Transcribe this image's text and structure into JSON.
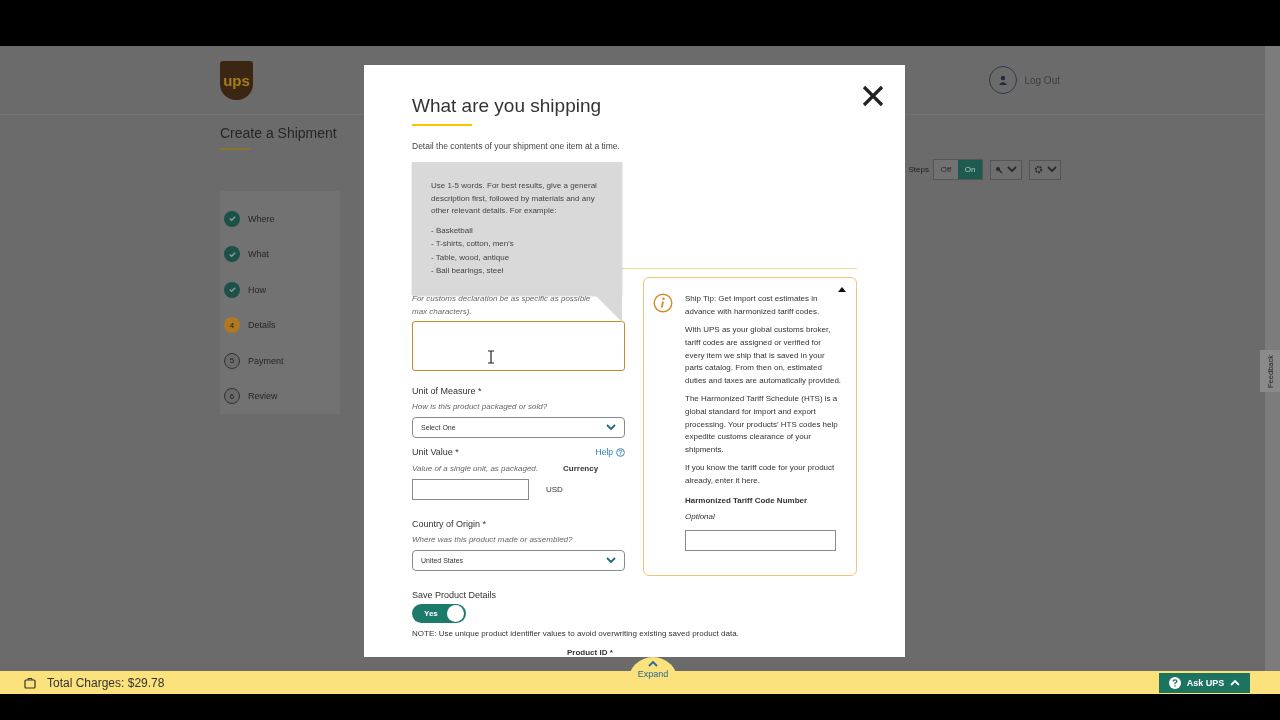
{
  "page": {
    "logo": "ups",
    "logout": "Log Out",
    "title": "Create a Shipment",
    "steps_toggle": {
      "label": "Steps",
      "options": [
        {
          "label": "Off",
          "selected": false
        },
        {
          "label": "On",
          "selected": true
        }
      ]
    },
    "steps": [
      {
        "label": "Where",
        "kind": "done"
      },
      {
        "label": "What",
        "kind": "done"
      },
      {
        "label": "How",
        "kind": "done"
      },
      {
        "label": "Details",
        "number": "4",
        "kind": "current"
      },
      {
        "label": "Payment",
        "number": "5",
        "kind": "todo"
      },
      {
        "label": "Review",
        "number": "6",
        "kind": "todo"
      }
    ],
    "feedback": "Feedback"
  },
  "modal": {
    "title": "What are you shipping",
    "description": "Detail the contents of your shipment one item at a time.",
    "tooltip": {
      "intro": "Use 1-5 words. For best results, give a general description first, followed by materials and any other relevant details. For example:",
      "examples": [
        "- Basketball",
        "- T-shirts, cotton, men's",
        "- Table, wood, antique",
        "- Ball bearings, steel"
      ]
    },
    "customs_hint": [
      "For customs declaration be as specific as possible",
      "max characters)."
    ],
    "description_field": {
      "focused": true
    },
    "unit_of_measure": {
      "label": "Unit of Measure *",
      "hint": "How is this product packaged or sold?",
      "value": "Select One"
    },
    "unit_value": {
      "label": "Unit Value *",
      "help": "Help",
      "hint": "Value of a single unit, as packaged.",
      "currency_label": "Currency",
      "currency": "USD"
    },
    "country": {
      "label": "Country of Origin *",
      "hint": "Where was this product made or assembled?",
      "value": "United States"
    },
    "tip": {
      "expanded": true,
      "paragraphs": [
        "Ship Tip: Get import cost estimates in advance with harmonized tariff codes.",
        "With UPS as your global customs broker, tariff codes are assigned or verified for every item we ship that is saved in your parts catalog. From then on, estimated duties and taxes are automatically provided.",
        "The Harmonized Tariff Schedule (HTS) is a global standard for import and export processing. Your products' HTS codes help expedite customs clearance of your shipments.",
        "If you know the tariff code for your product already, enter it here."
      ],
      "code_label": "Harmonized Tariff Code Number",
      "code_hint": "Optional"
    },
    "save": {
      "label": "Save Product Details",
      "toggle": {
        "label": "Yes",
        "on": true
      },
      "note": "NOTE: Use unique product identifier values to avoid overwriting existing saved product data."
    },
    "product_id_label": "Product ID *"
  },
  "footer": {
    "total": "Total Charges: $29.78",
    "expand": "Expand",
    "ask": "Ask UPS"
  }
}
